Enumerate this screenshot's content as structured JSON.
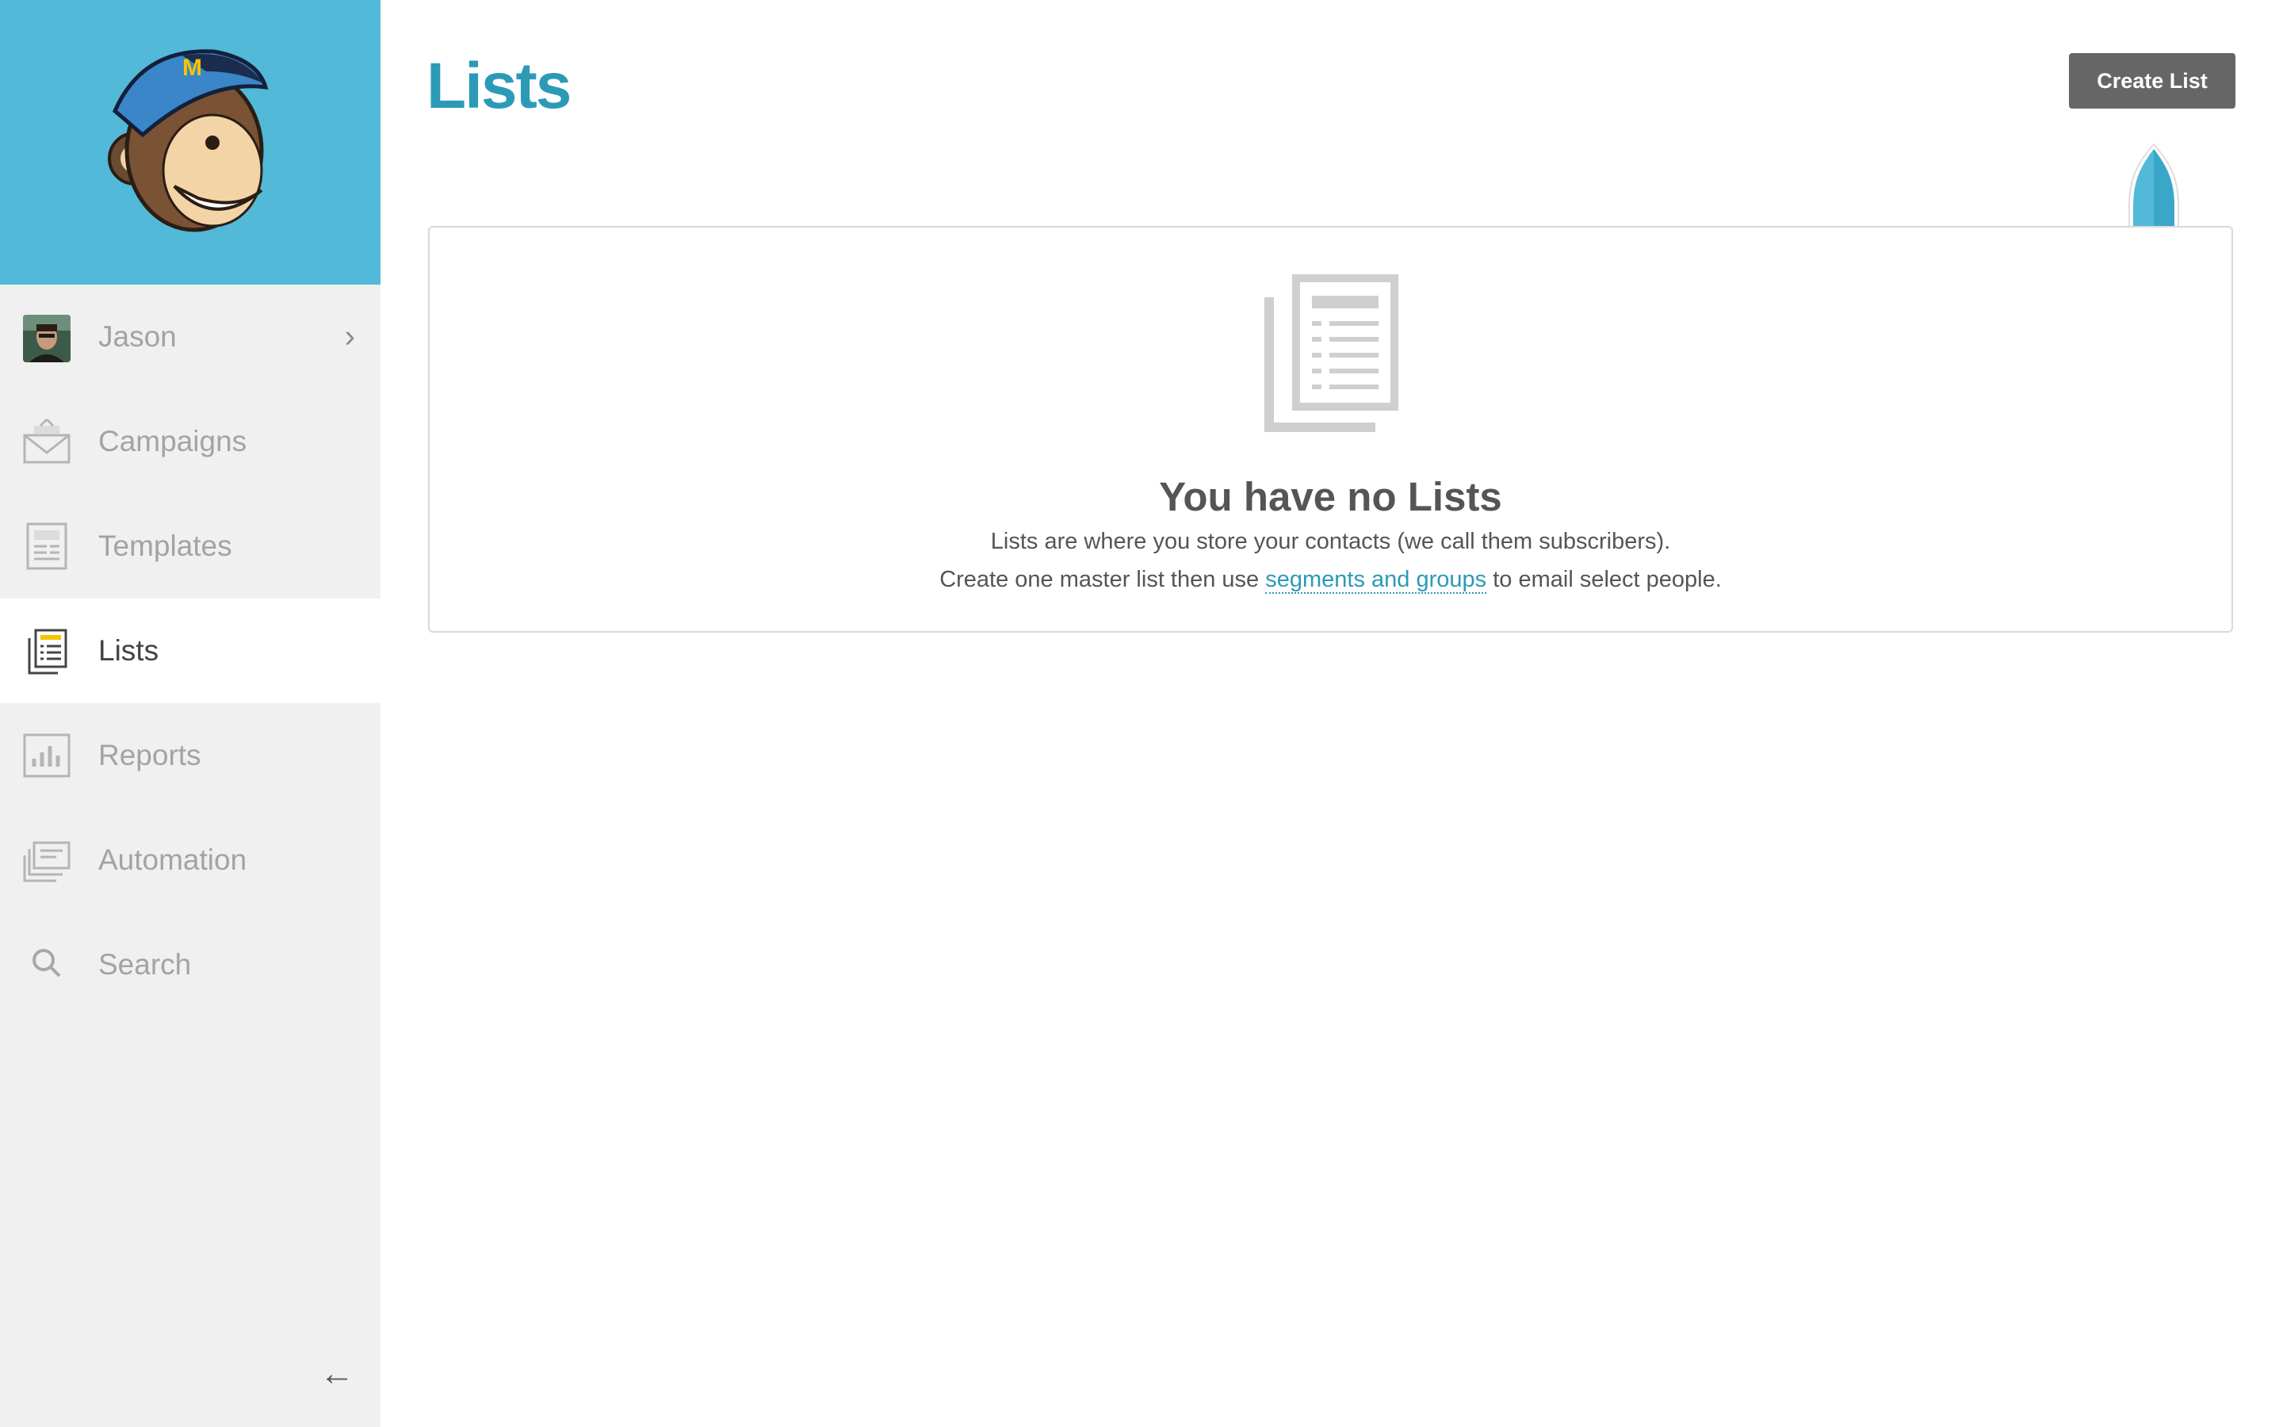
{
  "sidebar": {
    "user": {
      "name": "Jason"
    },
    "items": [
      {
        "label": "Campaigns",
        "icon": "envelope-icon"
      },
      {
        "label": "Templates",
        "icon": "template-icon"
      },
      {
        "label": "Lists",
        "icon": "list-icon",
        "active": true
      },
      {
        "label": "Reports",
        "icon": "bar-chart-icon"
      },
      {
        "label": "Automation",
        "icon": "automation-icon"
      },
      {
        "label": "Search",
        "icon": "search-icon"
      }
    ],
    "collapse_icon": "←",
    "chevron": "›"
  },
  "header": {
    "title": "Lists",
    "create_label": "Create List"
  },
  "empty_state": {
    "title": "You have no Lists",
    "line1": "Lists are where you store your contacts (we call them subscribers).",
    "line2_before": "Create one master list then use ",
    "line2_link": "segments and groups",
    "line2_after": " to email select people."
  },
  "colors": {
    "brand": "#52b9d8",
    "accent": "#2c9ab7",
    "button": "#666666"
  }
}
